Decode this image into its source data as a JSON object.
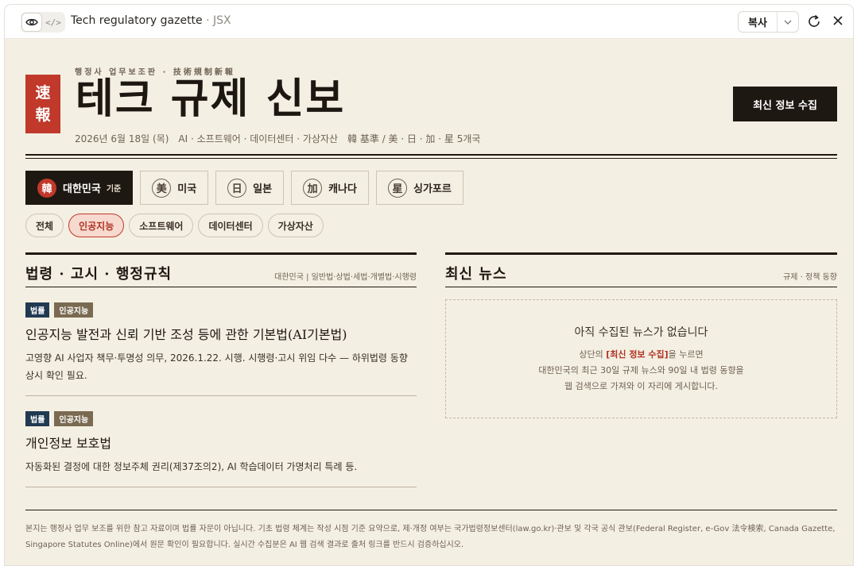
{
  "window": {
    "title": "Tech regulatory gazette",
    "title_ext": " · JSX",
    "copy_label": "복사"
  },
  "masthead": {
    "kicker": "행정사 업무보조판 · 技術規制新報",
    "seal_top": "速",
    "seal_bottom": "報",
    "title": "테크 규제 신보",
    "date": "2026년 6월 18일 (목)",
    "sectors": "AI · 소프트웨어 · 데이터센터 · 가상자산",
    "coverage": "韓 基準 / 美 · 日 · 加 · 星 5개국",
    "fetch_label": "최신 정보 수집"
  },
  "countries": [
    {
      "mark": "韓",
      "label": "대한민국",
      "sub": "기준"
    },
    {
      "mark": "美",
      "label": "미국"
    },
    {
      "mark": "日",
      "label": "일본"
    },
    {
      "mark": "加",
      "label": "캐나다"
    },
    {
      "mark": "星",
      "label": "싱가포르"
    }
  ],
  "chips": [
    "전체",
    "인공지능",
    "소프트웨어",
    "데이터센터",
    "가상자산"
  ],
  "laws": {
    "heading": "법령 · 고시 · 행정규칙",
    "meta": "대한민국 | 일반법·상법·세법·개별법·시행령",
    "entries": [
      {
        "tags": [
          "법률",
          "인공지능"
        ],
        "title": "인공지능 발전과 신뢰 기반 조성 등에 관한 기본법(AI기본법)",
        "desc": "고영향 AI 사업자 책무·투명성 의무, 2026.1.22. 시행. 시행령·고시 위임 다수 — 하위법령 동향 상시 확인 필요."
      },
      {
        "tags": [
          "법률",
          "인공지능"
        ],
        "title": "개인정보 보호법",
        "desc": "자동화된 결정에 대한 정보주체 권리(제37조의2), AI 학습데이터 가명처리 특례 등."
      }
    ]
  },
  "news": {
    "heading": "최신 뉴스",
    "meta": "규제 · 정책 동향",
    "empty_title": "아직 수집된 뉴스가 없습니다",
    "empty_pre": "상단의 ",
    "empty_highlight": "[최신 정보 수집]",
    "empty_post": "을 누르면",
    "empty_line2": "대한민국의 최근 30일 규제 뉴스와 90일 내 법령 동향을",
    "empty_line3": "웹 검색으로 가져와 이 자리에 게시합니다."
  },
  "footer": "본지는 행정사 업무 보조를 위한 참고 자료이며 법률 자문이 아닙니다. 기초 법령 체계는 작성 시점 기준 요약으로, 제·개정 여부는 국가법령정보센터(law.go.kr)·관보 및 각국 공식 관보(Federal Register, e-Gov 法令検索, Canada Gazette, Singapore Statutes Online)에서 원문 확인이 필요합니다. 실시간 수집분은 AI 웹 검색 결과로 출처 링크를 반드시 검증하십시오."
}
